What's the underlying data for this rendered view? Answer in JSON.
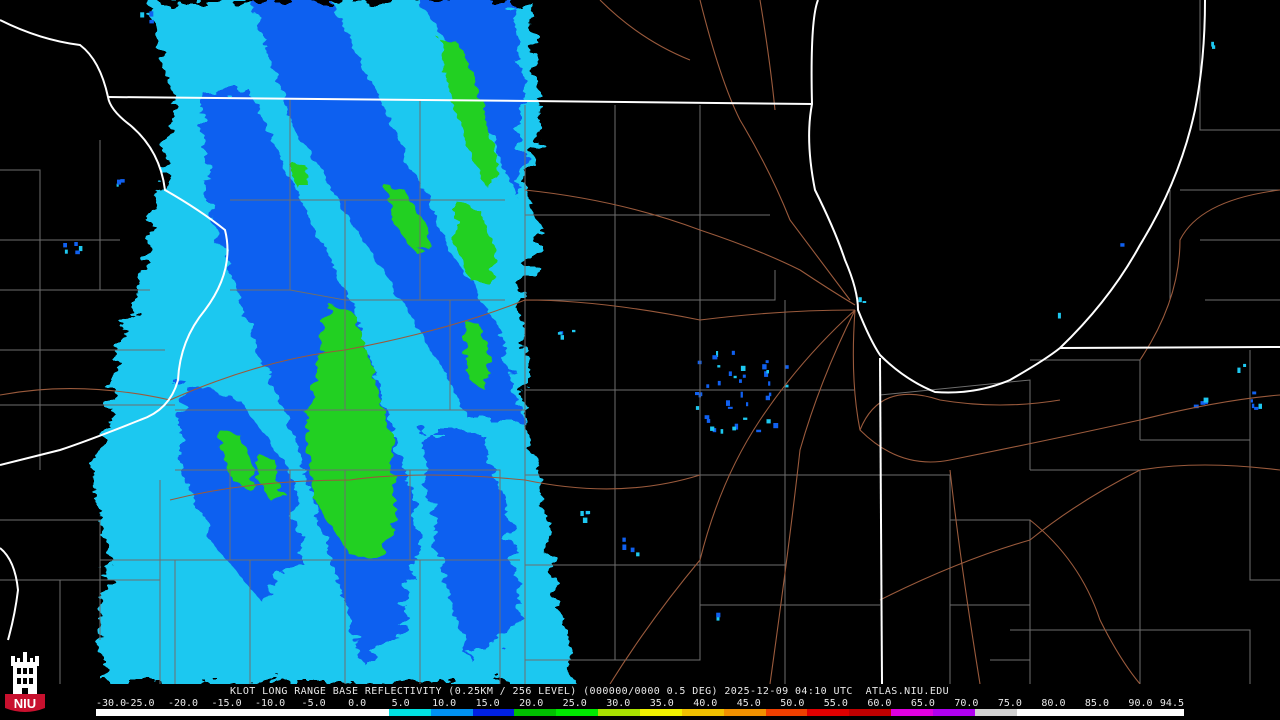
{
  "product_caption": "KLOT LONG RANGE BASE REFLECTIVITY (0.25KM / 256 LEVEL) (000000/0000 0.5 DEG) 2025-12-09 04:10 UTC  ATLAS.NIU.EDU",
  "color_scale": {
    "labels": [
      "-30.0",
      "-25.0",
      "-20.0",
      "-15.0",
      "-10.0",
      "-5.0",
      "0.0",
      "5.0",
      "10.0",
      "15.0",
      "20.0",
      "25.0",
      "30.0",
      "35.0",
      "40.0",
      "45.0",
      "50.0",
      "55.0",
      "60.0",
      "65.0",
      "70.0",
      "75.0",
      "80.0",
      "85.0",
      "90.0",
      "94.5"
    ],
    "colors": [
      "#ffffff",
      "#ffffff",
      "#ffffff",
      "#ffffff",
      "#ffffff",
      "#ffffff",
      "#ffffff",
      "#00e0e0",
      "#0090f0",
      "#0020e0",
      "#00c000",
      "#00e800",
      "#a8e000",
      "#f0f000",
      "#f0c000",
      "#f09000",
      "#f04000",
      "#e00000",
      "#c00000",
      "#e000e0",
      "#b000f0",
      "#d0d0d0",
      "#ffffff",
      "#ffffff",
      "#ffffff",
      "#ffffff"
    ]
  },
  "logo": {
    "text": "NIU",
    "colors": {
      "shield": "#c8102e",
      "tower": "#ffffff"
    }
  },
  "map_colors": {
    "state_border": "#ffffff",
    "county_line": "#6e6e6e",
    "road": "#9a5a3c",
    "echo_light": "#1ec8f0",
    "echo_mid": "#1060f0",
    "echo_heavy": "#20d020"
  }
}
